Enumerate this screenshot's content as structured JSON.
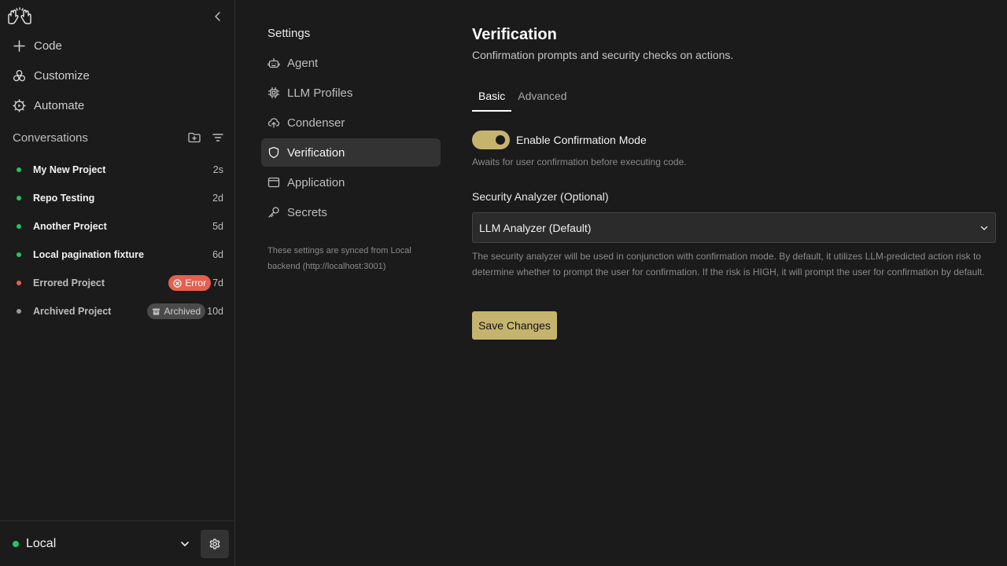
{
  "sidebar": {
    "logo_icon": "hands-logo-icon",
    "nav": [
      {
        "label": "Code",
        "icon": "plus-icon"
      },
      {
        "label": "Customize",
        "icon": "nodes-icon"
      },
      {
        "label": "Automate",
        "icon": "gear-play-icon"
      }
    ],
    "conversations": {
      "heading": "Conversations",
      "items": [
        {
          "title": "My New Project",
          "age": "2s",
          "status": "active"
        },
        {
          "title": "Repo Testing",
          "age": "2d",
          "status": "active"
        },
        {
          "title": "Another Project",
          "age": "5d",
          "status": "active"
        },
        {
          "title": "Local pagination fixture",
          "age": "6d",
          "status": "active"
        },
        {
          "title": "Errored Project",
          "age": "7d",
          "status": "error",
          "badge": "Error"
        },
        {
          "title": "Archived Project",
          "age": "10d",
          "status": "archived",
          "badge": "Archived"
        }
      ]
    },
    "footer": {
      "backend": "Local"
    }
  },
  "settings_nav": {
    "heading": "Settings",
    "items": [
      {
        "label": "Agent",
        "icon": "robot-icon"
      },
      {
        "label": "LLM Profiles",
        "icon": "chip-icon"
      },
      {
        "label": "Condenser",
        "icon": "cloud-upload-icon"
      },
      {
        "label": "Verification",
        "icon": "shield-icon",
        "active": true
      },
      {
        "label": "Application",
        "icon": "window-icon"
      },
      {
        "label": "Secrets",
        "icon": "key-icon"
      }
    ],
    "sync_note": "These settings are synced from Local backend (http://localhost:3001)"
  },
  "main": {
    "title": "Verification",
    "subtitle": "Confirmation prompts and security checks on actions.",
    "tabs": [
      {
        "label": "Basic",
        "active": true
      },
      {
        "label": "Advanced",
        "active": false
      }
    ],
    "confirmation": {
      "label": "Enable Confirmation Mode",
      "enabled": true,
      "help": "Awaits for user confirmation before executing code."
    },
    "analyzer": {
      "label": "Security Analyzer (Optional)",
      "value": "LLM Analyzer (Default)",
      "help": "The security analyzer will be used in conjunction with confirmation mode. By default, it utilizes LLM-predicted action risk to determine whether to prompt the user for confirmation. If the risk is HIGH, it will prompt the user for confirmation by default."
    },
    "save_label": "Save Changes"
  },
  "colors": {
    "accent": "#c5b46e",
    "status_active": "#22c55e",
    "status_error": "#e5604f",
    "status_archived": "#9a9a9a",
    "background": "#1b1b1b"
  }
}
